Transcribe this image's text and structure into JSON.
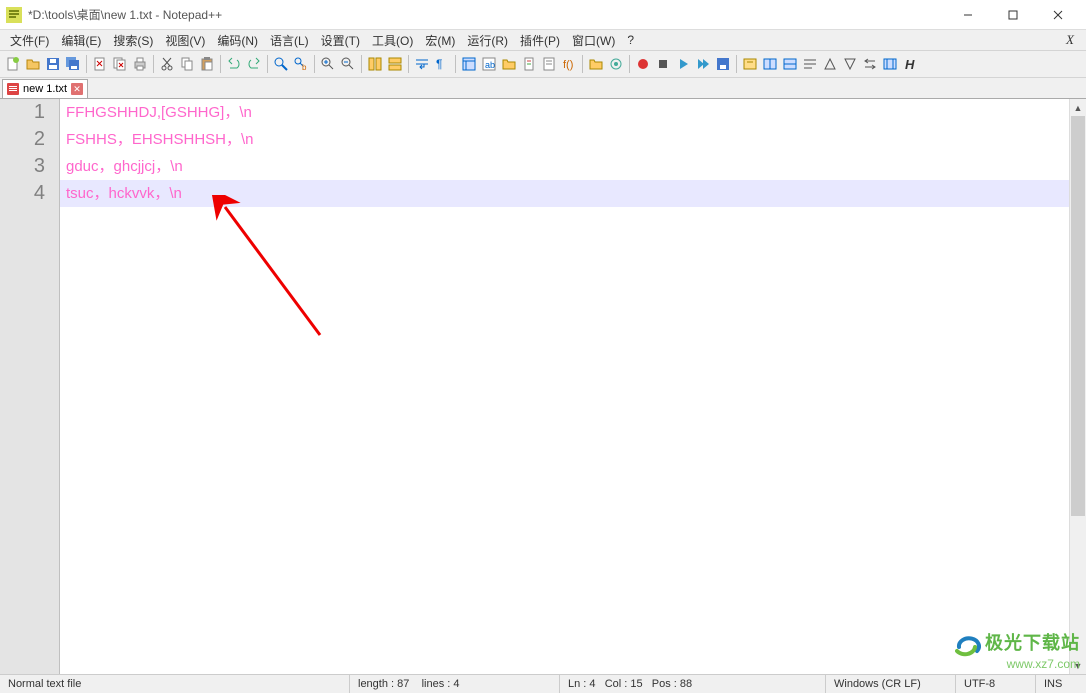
{
  "window": {
    "title": "*D:\\tools\\桌面\\new 1.txt - Notepad++"
  },
  "menu": {
    "items": [
      "文件(F)",
      "编辑(E)",
      "搜索(S)",
      "视图(V)",
      "编码(N)",
      "语言(L)",
      "设置(T)",
      "工具(O)",
      "宏(M)",
      "运行(R)",
      "插件(P)",
      "窗口(W)",
      "?"
    ]
  },
  "tabs": {
    "items": [
      {
        "label": "new 1.txt"
      }
    ]
  },
  "editor": {
    "lines_nums": [
      "1",
      "2",
      "3",
      "4"
    ],
    "lines": [
      "FFHGSHHDJ,[GSHHG]，\\n",
      "FSHHS，EHSHSHHSH，\\n",
      "gduc，ghcjjcj，\\n",
      "tsuc，hckvvk，\\n"
    ],
    "active_line": 4
  },
  "status": {
    "mode": "Normal text file",
    "length_label": "length : 87",
    "lines_label": "lines : 4",
    "ln_label": "Ln : 4",
    "col_label": "Col : 15",
    "pos_label": "Pos : 88",
    "eol": "Windows (CR LF)",
    "encoding": "UTF-8",
    "ins": "INS"
  },
  "watermark": {
    "brand": "极光下载站",
    "url": "www.xz7.com"
  }
}
